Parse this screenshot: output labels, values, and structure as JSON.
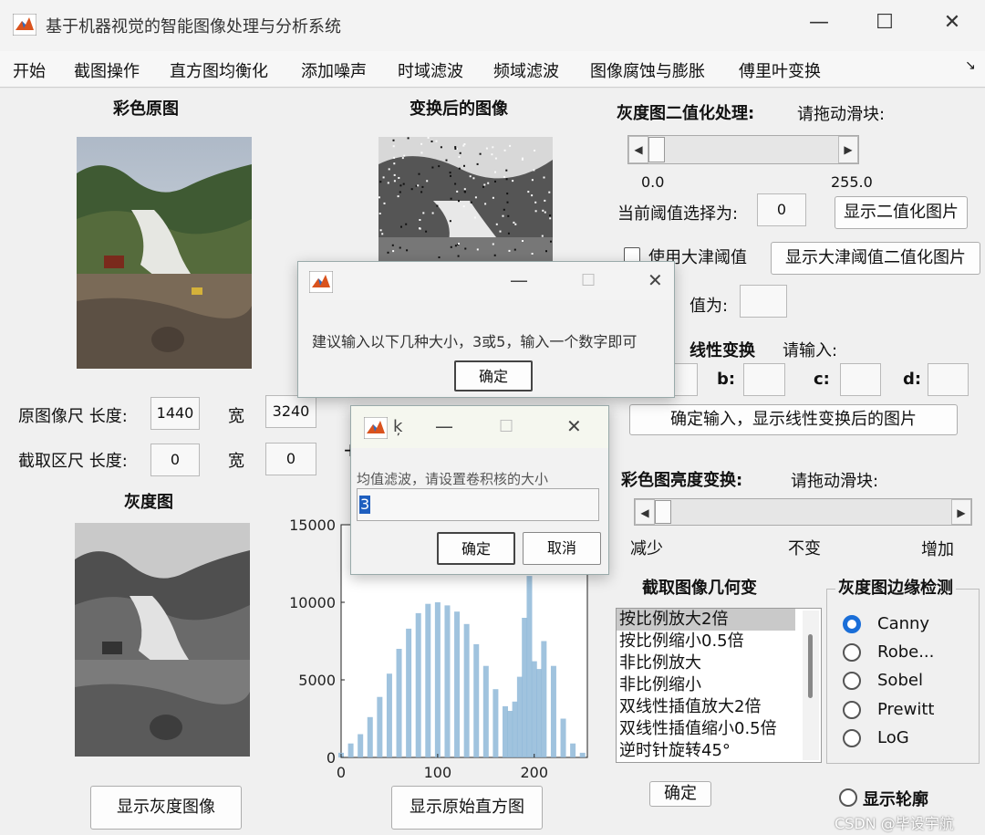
{
  "window": {
    "title": "基于机器视觉的智能图像处理与分析系统",
    "controls": [
      "—",
      "☐",
      "✕"
    ]
  },
  "menu": [
    "开始",
    "截图操作",
    "直方图均衡化",
    "添加噪声",
    "时域滤波",
    "频域滤波",
    "图像腐蚀与膨胀",
    "傅里叶变换",
    "↘"
  ],
  "left": {
    "color_title": "彩色原图",
    "orig_size_label": "原图像尺 长度:",
    "orig_length": "1440",
    "orig_width_label": "宽",
    "orig_width": "3240",
    "crop_size_label": "截取区尺 长度:",
    "crop_length": "0",
    "crop_width_label": "宽",
    "crop_width": "0",
    "gray_title": "灰度图",
    "show_gray_button": "显示灰度图像"
  },
  "middle": {
    "transformed_title": "变换后的图像",
    "show_hist_button": "显示原始直方图",
    "plus_mark": "+"
  },
  "histogram": {
    "chart_data": {
      "type": "bar",
      "x_ticks": [
        0,
        100,
        200
      ],
      "y_ticks": [
        0,
        5000,
        10000,
        15000
      ],
      "xlim": [
        0,
        255
      ],
      "ylim": [
        0,
        15000
      ],
      "x": [
        0,
        10,
        20,
        30,
        40,
        50,
        60,
        70,
        80,
        90,
        100,
        110,
        120,
        130,
        140,
        150,
        160,
        170,
        175,
        180,
        185,
        190,
        195,
        200,
        205,
        210,
        220,
        230,
        240,
        250
      ],
      "values": [
        300,
        900,
        1500,
        2600,
        3900,
        5400,
        7000,
        8300,
        9300,
        9900,
        10000,
        9800,
        9400,
        8600,
        7300,
        5900,
        4400,
        3300,
        3000,
        3600,
        5200,
        9000,
        11700,
        6200,
        5700,
        7500,
        5900,
        2500,
        900,
        300
      ]
    }
  },
  "right": {
    "binarize_title": "灰度图二值化处理:",
    "binarize_hint": "请拖动滑块:",
    "slider_min": "0.0",
    "slider_max": "255.0",
    "threshold_label": "当前阈值选择为:",
    "threshold_value": "0",
    "show_binary_button": "显示二值化图片",
    "otsu_checkbox_label": "使用大津阈值",
    "show_otsu_button": "显示大津阈值二值化图片",
    "otsu_value_label": "值为:",
    "linear_title": "线性变换",
    "linear_hint": "请输入:",
    "b_label": "b:",
    "c_label": "c:",
    "d_label": "d:",
    "linear_button": "确定输入，显示线性变换后的图片",
    "brightness_title": "彩色图亮度变换:",
    "brightness_hint": "请拖动滑块:",
    "brightness_decrease": "减少",
    "brightness_same": "不变",
    "brightness_increase": "增加",
    "geom_title": "截取图像几何变",
    "geom_items": [
      "按比例放大2倍",
      "按比例缩小0.5倍",
      "非比例放大",
      "非比例缩小",
      "双线性插值放大2倍",
      "双线性插值缩小0.5倍",
      "逆时针旋转45°"
    ],
    "geom_confirm": "确定",
    "edge_title": "灰度图边缘检测",
    "edge_options": [
      "Canny",
      "Robe...",
      "Sobel",
      "Prewitt",
      "LoG"
    ],
    "show_contour_label": "显示轮廓"
  },
  "dialog1": {
    "message": "建议输入以下几种大小，3或5，输入一个数字即可",
    "ok": "确定",
    "controls": [
      "—",
      "☐",
      "✕"
    ]
  },
  "dialog2": {
    "title_fragment": "ķ",
    "prompt": "均值滤波，请设置卷积核的大小",
    "input_value": "3",
    "ok": "确定",
    "cancel": "取消",
    "controls": [
      "—",
      "☐",
      "✕"
    ]
  },
  "watermark": "CSDN @毕设宇航",
  "colors": {
    "histogram_bar": "#8fb8d8",
    "radio_selected": "#1a6ed8",
    "window_bg": "#f0f0f0"
  }
}
